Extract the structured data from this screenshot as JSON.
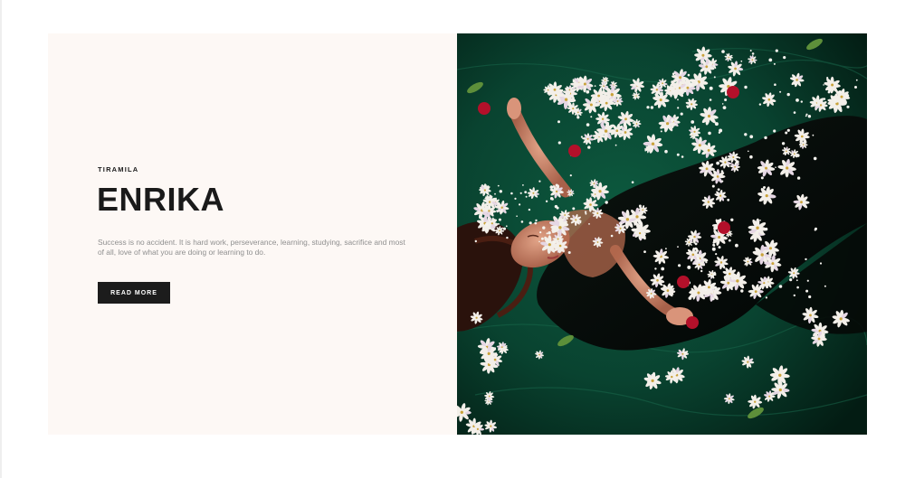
{
  "hero": {
    "eyebrow": "TIRAMILA",
    "title": "ENRIKA",
    "description": "Success is no accident. It is hard work, perseverance, learning, studying, sacrifice and most of all, love of what you are doing or learning to do.",
    "cta_label": "READ MORE"
  },
  "colors": {
    "panel_bg": "#fdf8f5",
    "title": "#1a1a1a",
    "button_bg": "#1c1c1c",
    "water": "#0a3e2c"
  }
}
